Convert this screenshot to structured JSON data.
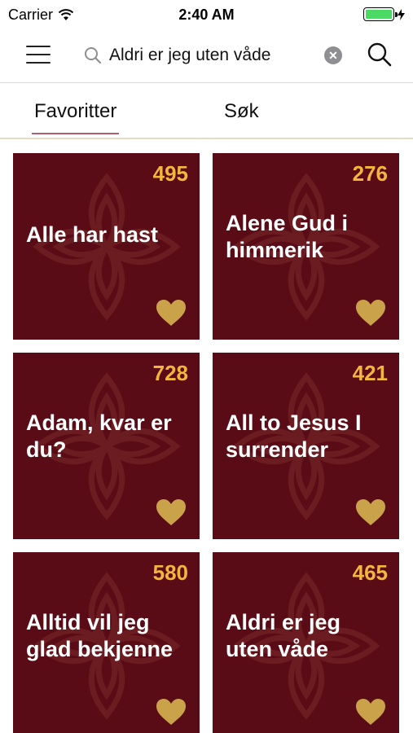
{
  "status_bar": {
    "carrier": "Carrier",
    "time": "2:40 AM",
    "battery_level": 1.0
  },
  "header": {
    "search_value": "Aldri er jeg uten våde",
    "menu_icon": "hamburger-menu-icon",
    "search_icon": "magnifier-icon",
    "clear_icon": "clear-x-icon"
  },
  "tabs": {
    "favorites": "Favoritter",
    "search": "Søk",
    "active": "favorites"
  },
  "colors": {
    "card_bg": "#5a0c16",
    "number": "#f2b63c",
    "heart": "#c9a24a",
    "tab_underline": "#b35c6b"
  },
  "cards": [
    {
      "number": "495",
      "title": "Alle har hast"
    },
    {
      "number": "276",
      "title": "Alene Gud i himmerik"
    },
    {
      "number": "728",
      "title": "Adam, kvar er du?"
    },
    {
      "number": "421",
      "title": "All to Jesus I surrender"
    },
    {
      "number": "580",
      "title": "Alltid vil jeg glad bekjenne"
    },
    {
      "number": "465",
      "title": "Aldri er jeg uten våde"
    }
  ]
}
